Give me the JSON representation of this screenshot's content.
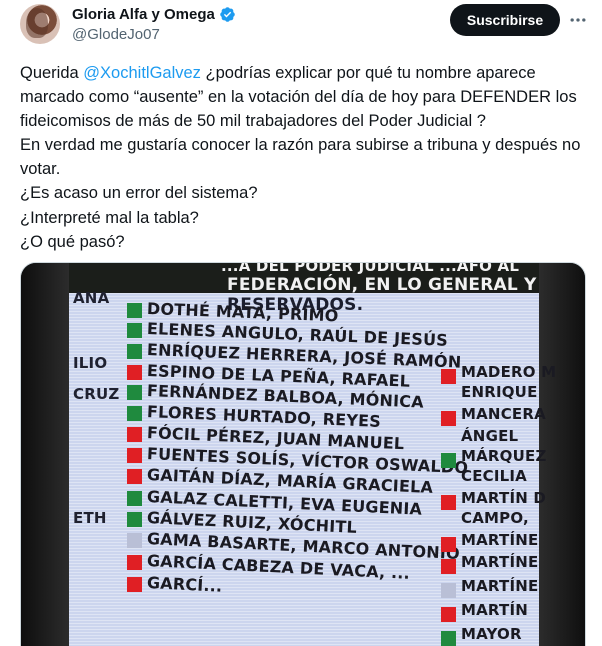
{
  "author": {
    "display_name": "Gloria Alfa y Omega",
    "handle": "@GlodeJo07",
    "verified_icon": "verified-badge-icon",
    "avatar": "avatar"
  },
  "actions": {
    "subscribe_label": "Suscribirse",
    "more_icon": "more-horizontal-icon"
  },
  "tweet": {
    "prefix": "Querida ",
    "mention": "@XochitlGalvez",
    "body": " ¿podrías explicar por qué tu nombre aparece marcado como “ausente” en la votación del día de hoy para DEFENDER los fideicomisos de más de 50 mil trabajadores del Poder Judicial ?\nEn verdad me gustaría conocer la razón para subirse a tribuna y después no votar.\n¿Es acaso un error del sistema?\n¿Interpreté mal la tabla?\n¿O qué pasó?"
  },
  "image": {
    "header_lines": [
      "FEDERACIÓN, EN LO GENERAL Y",
      "RESERVADOS."
    ],
    "header_top_fragment": "...A DEL PODER JUDICIAL ...AFO AL",
    "left_fragments": [
      "ANA",
      "ILIO",
      "CRUZ",
      "ETH"
    ],
    "names": [
      "DOTHÉ MATA, PRIMO",
      "ELENES ANGULO, RAÚL DE JESÚS",
      "ENRÍQUEZ HERRERA, JOSÉ RAMÓN",
      "ESPINO DE LA PEÑA, RAFAEL",
      "FERNÁNDEZ BALBOA, MÓNICA",
      "FLORES HURTADO, REYES",
      "FÓCIL PÉREZ, JUAN MANUEL",
      "FUENTES SOLÍS, VÍCTOR OSWALDO",
      "GAITÁN DÍAZ, MARÍA GRACIELA",
      "GALAZ CALETTI, EVA EUGENIA",
      "GÁLVEZ RUIZ, XÓCHITL",
      "GAMA BASARTE, MARCO ANTONIO",
      "GARCÍA CABEZA DE VACA, ...",
      "GARCÍ..."
    ],
    "right_fragments": [
      "MADERO M",
      "ENRIQUE",
      "MANCERA",
      "ÁNGEL",
      "MÁRQUEZ",
      "CECILIA",
      "MARTÍN D",
      "CAMPO, ",
      "MARTÍNE",
      "MARTÍNE",
      "MARTÍNE",
      "MARTÍN",
      "MAYOR"
    ],
    "colors": {
      "favor": "#1f8a3e",
      "contra": "#e01f24",
      "ausente": "#b9bfd6",
      "board": "#ccd5ee"
    }
  }
}
